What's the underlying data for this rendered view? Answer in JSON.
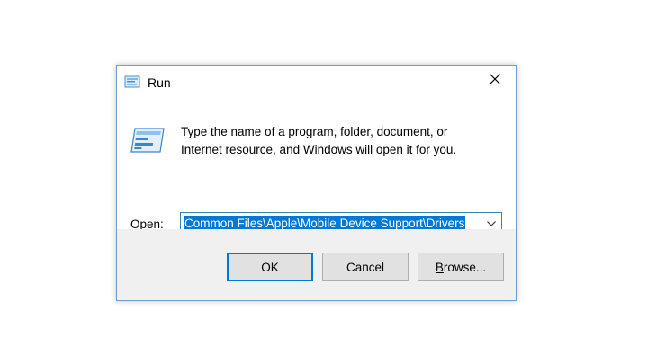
{
  "window": {
    "title": "Run",
    "title_icon": "run-icon",
    "close_icon": "close-icon"
  },
  "description": {
    "line1": "Type the name of a program, folder, document, or",
    "line2": "Internet resource, and Windows will open it for you."
  },
  "open_field": {
    "label_accel": "O",
    "label_rest": "pen:",
    "value": "Common Files\\Apple\\Mobile Device Support\\Drivers",
    "dropdown_icon": "chevron-down-icon"
  },
  "buttons": {
    "ok": "OK",
    "cancel": "Cancel",
    "browse_accel": "B",
    "browse_rest": "rowse..."
  },
  "colors": {
    "selection": "#0078d7",
    "default_button_border": "#0078d7",
    "footer_bg": "#f0f0f0"
  }
}
